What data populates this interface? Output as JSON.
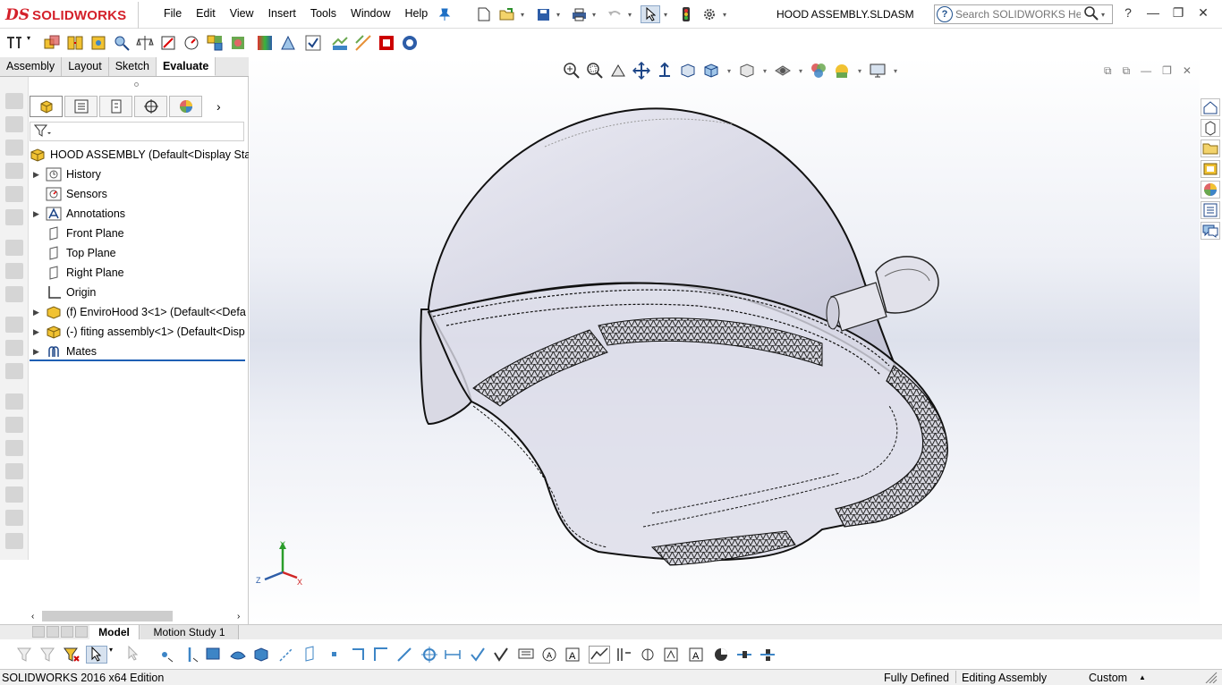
{
  "app": {
    "logo_ds": "DS",
    "logo_name": "SOLIDWORKS",
    "document_title": "HOOD ASSEMBLY.SLDASM"
  },
  "menu": [
    "File",
    "Edit",
    "View",
    "Insert",
    "Tools",
    "Window",
    "Help"
  ],
  "search": {
    "placeholder": "Search SOLIDWORKS Help",
    "help_glyph": "?"
  },
  "window_controls": {
    "help": "?",
    "minimize": "—",
    "restore": "❐",
    "close": "✕"
  },
  "command_tabs": [
    {
      "label": "Assembly",
      "active": false
    },
    {
      "label": "Layout",
      "active": false
    },
    {
      "label": "Sketch",
      "active": false
    },
    {
      "label": "Evaluate",
      "active": true
    }
  ],
  "feature_tree": {
    "root": "HOOD ASSEMBLY  (Default<Display State",
    "items": [
      {
        "label": "History",
        "expandable": true,
        "icon": "history-icon"
      },
      {
        "label": "Sensors",
        "expandable": false,
        "icon": "sensor-icon"
      },
      {
        "label": "Annotations",
        "expandable": true,
        "icon": "annotation-icon"
      },
      {
        "label": "Front Plane",
        "expandable": false,
        "icon": "plane-icon"
      },
      {
        "label": "Top Plane",
        "expandable": false,
        "icon": "plane-icon"
      },
      {
        "label": "Right Plane",
        "expandable": false,
        "icon": "plane-icon"
      },
      {
        "label": "Origin",
        "expandable": false,
        "icon": "origin-icon"
      },
      {
        "label": "(f) EnviroHood 3<1> (Default<<Defa",
        "expandable": true,
        "icon": "part-icon"
      },
      {
        "label": "(-) fiting assembly<1> (Default<Disp",
        "expandable": true,
        "icon": "subassembly-icon"
      },
      {
        "label": "Mates",
        "expandable": true,
        "icon": "mates-icon"
      }
    ]
  },
  "bottom_tabs": {
    "model": "Model",
    "motion": "Motion Study 1"
  },
  "triad": {
    "x": "X",
    "y": "Y",
    "z": "Z"
  },
  "status": {
    "edition": "SOLIDWORKS 2016 x64 Edition",
    "definition": "Fully Defined",
    "mode": "Editing Assembly",
    "units": "Custom",
    "units_arrow": "▲"
  }
}
